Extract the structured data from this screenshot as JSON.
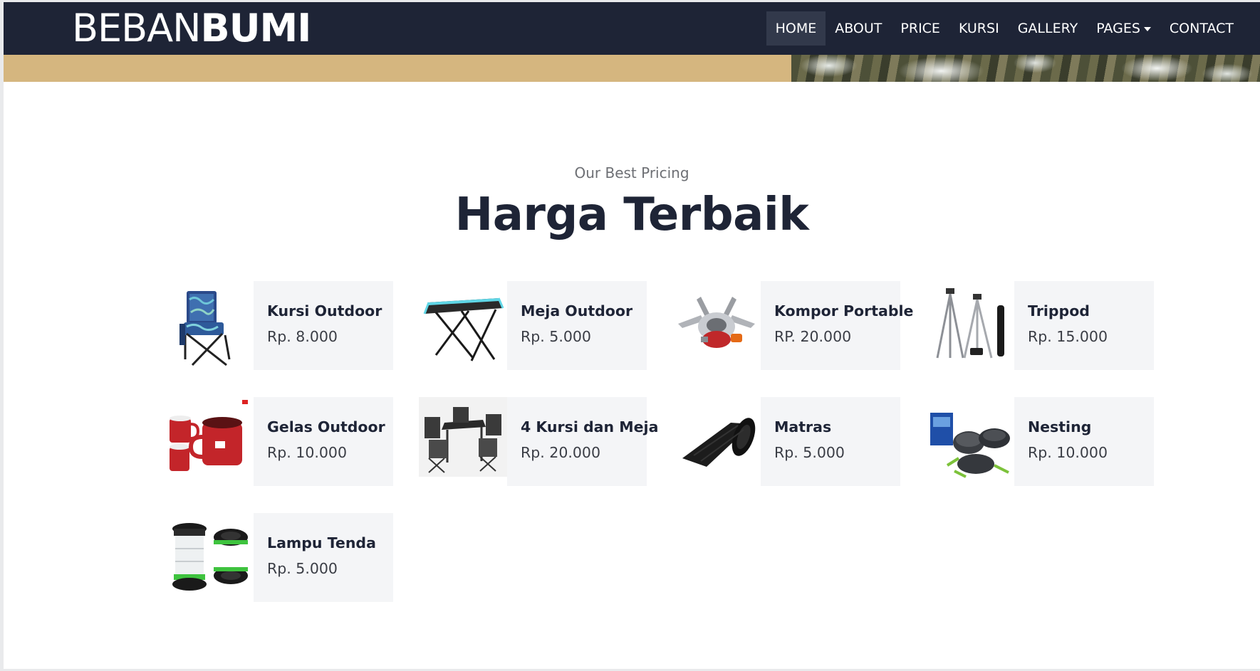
{
  "brand": {
    "part1": "BEBAN",
    "part2": "BUMI"
  },
  "nav": {
    "items": [
      {
        "label": "HOME",
        "active": true
      },
      {
        "label": "ABOUT",
        "active": false
      },
      {
        "label": "PRICE",
        "active": false
      },
      {
        "label": "KURSI",
        "active": false
      },
      {
        "label": "GALLERY",
        "active": false
      },
      {
        "label": "PAGES",
        "active": false,
        "dropdown": true
      },
      {
        "label": "CONTACT",
        "active": false
      }
    ]
  },
  "section": {
    "subtitle": "Our Best Pricing",
    "title": "Harga Terbaik"
  },
  "products": [
    {
      "name": "Kursi Outdoor",
      "price": "Rp. 8.000",
      "icon": "camping-chair-icon"
    },
    {
      "name": "Meja Outdoor",
      "price": "Rp. 5.000",
      "icon": "folding-table-icon"
    },
    {
      "name": "Kompor Portable",
      "price": "RP. 20.000",
      "icon": "portable-stove-icon"
    },
    {
      "name": "Trippod",
      "price": "Rp. 15.000",
      "icon": "tripod-icon"
    },
    {
      "name": "Gelas Outdoor",
      "price": "Rp. 10.000",
      "icon": "enamel-mug-icon"
    },
    {
      "name": "4 Kursi dan Meja",
      "price": "Rp. 20.000",
      "icon": "table-chair-set-icon"
    },
    {
      "name": "Matras",
      "price": "Rp. 5.000",
      "icon": "sleeping-mat-icon"
    },
    {
      "name": "Nesting",
      "price": "Rp. 10.000",
      "icon": "cookware-set-icon"
    },
    {
      "name": "Lampu Tenda",
      "price": "Rp. 5.000",
      "icon": "tent-lantern-icon"
    }
  ],
  "colors": {
    "navbar": "#1e2436",
    "nav_active": "#32394b",
    "hero_sand": "#d5b67f",
    "card_bg": "#f4f5f7",
    "title": "#1e2436"
  }
}
